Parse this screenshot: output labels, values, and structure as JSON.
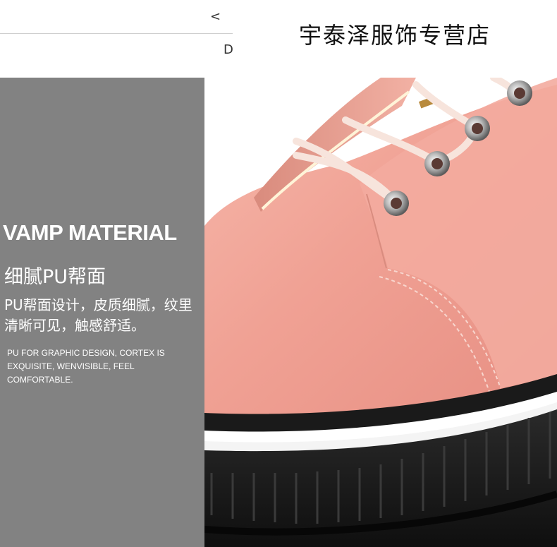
{
  "nav": {
    "prev_label": "<",
    "cut_letter": "D"
  },
  "shop": {
    "name": "宇泰泽服饰专营店"
  },
  "feature": {
    "title": "VAMP MATERIAL",
    "cn_title": "细腻PU帮面",
    "cn_description": "PU帮面设计，皮质细腻，纹里清晰可见，触感舒适。",
    "en_description": "PU FOR GRAPHIC DESIGN, CORTEX IS EXQUISITE, WENVISIBLE, FEEL COMFORTABLE."
  },
  "colors": {
    "panel": "#828282",
    "leather": "#f0a79b",
    "sole": "#1c1c1c",
    "lace": "#f7e4dc"
  },
  "photo": {
    "subject": "pink leather lace-up shoe close-up"
  }
}
